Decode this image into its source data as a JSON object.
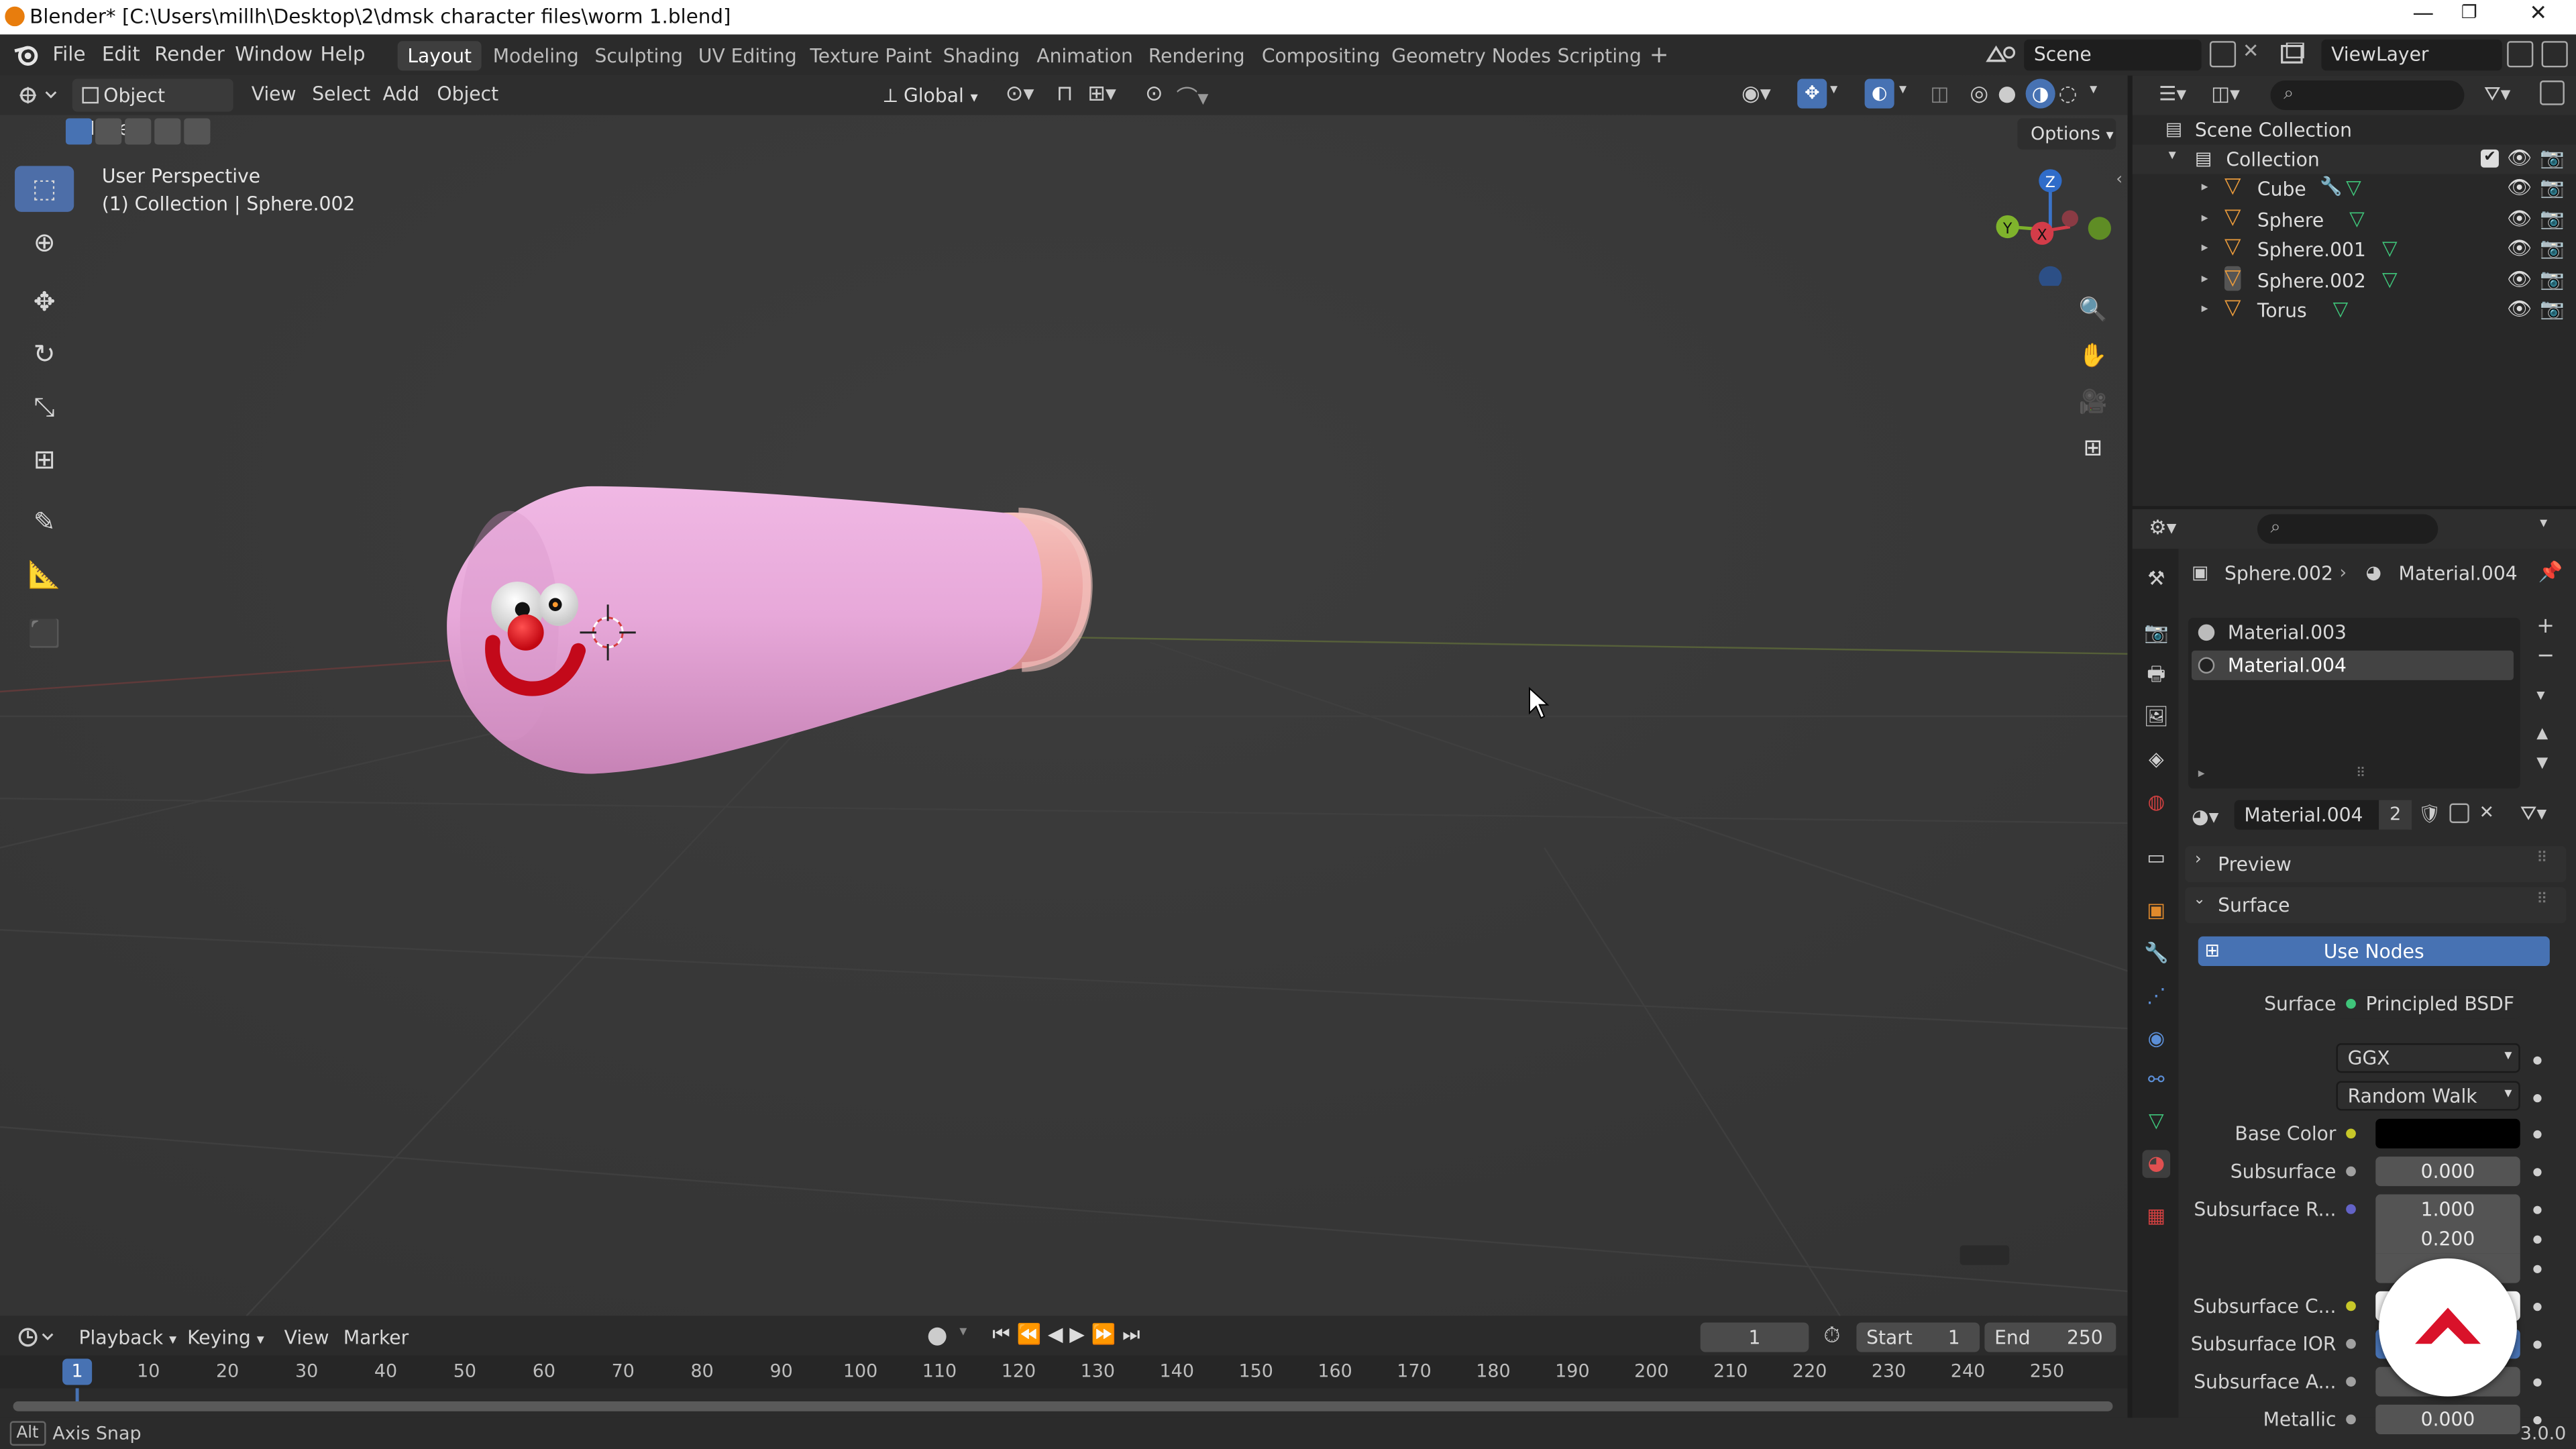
{
  "window": {
    "title": "Blender* [C:\\Users\\millh\\Desktop\\2\\dmsk character files\\worm 1.blend]",
    "controls": [
      "—",
      "❐",
      "✕"
    ]
  },
  "menu": {
    "items": [
      "File",
      "Edit",
      "Render",
      "Window",
      "Help"
    ],
    "workspaces": [
      "Layout",
      "Modeling",
      "Sculpting",
      "UV Editing",
      "Texture Paint",
      "Shading",
      "Animation",
      "Rendering",
      "Compositing",
      "Geometry Nodes",
      "Scripting"
    ],
    "active_workspace": "Layout",
    "add_tab": "+",
    "scene": "Scene",
    "view_layer": "ViewLayer"
  },
  "viewport": {
    "mode": "Object Mode",
    "menus": [
      "View",
      "Select",
      "Add",
      "Object"
    ],
    "orientation": "Global",
    "options_label": "Options",
    "perspective": "User Perspective",
    "collection_info": "(1) Collection | Sphere.002",
    "gizmo": {
      "x": "X",
      "y": "Y",
      "z": "Z"
    },
    "tools": [
      "select-box",
      "cursor",
      "move",
      "rotate",
      "scale",
      "transform",
      "annotate",
      "measure",
      "add-cube"
    ],
    "active_tool": "select-box"
  },
  "timeline": {
    "menus": [
      "Playback",
      "Keying",
      "View",
      "Marker"
    ],
    "current_frame": "1",
    "start_label": "Start",
    "start": "1",
    "end_label": "End",
    "end": "250",
    "ticks": [
      "1",
      "10",
      "20",
      "30",
      "40",
      "50",
      "60",
      "70",
      "80",
      "90",
      "100",
      "110",
      "120",
      "130",
      "140",
      "150",
      "160",
      "170",
      "180",
      "190",
      "200",
      "210",
      "220",
      "230",
      "240",
      "250"
    ],
    "tick_frames": [
      1,
      10,
      20,
      30,
      40,
      50,
      60,
      70,
      80,
      90,
      100,
      110,
      120,
      130,
      140,
      150,
      160,
      170,
      180,
      190,
      200,
      210,
      220,
      230,
      240,
      250
    ]
  },
  "status": {
    "key": "Alt",
    "hint": "Axis Snap",
    "version": "3.0.0"
  },
  "outliner": {
    "scene_collection": "Scene Collection",
    "collection": "Collection",
    "objects": [
      {
        "name": "Cube",
        "selected": false
      },
      {
        "name": "Sphere",
        "selected": false
      },
      {
        "name": "Sphere.001",
        "selected": false
      },
      {
        "name": "Sphere.002",
        "selected": true
      },
      {
        "name": "Torus",
        "selected": false
      }
    ]
  },
  "properties": {
    "breadcrumb_object": "Sphere.002",
    "breadcrumb_material": "Material.004",
    "material_slots": [
      {
        "name": "Material.003",
        "active": false
      },
      {
        "name": "Material.004",
        "active": true
      }
    ],
    "material_name": "Material.004",
    "user_count": "2",
    "preview_label": "Preview",
    "surface_panel": "Surface",
    "use_nodes": "Use Nodes",
    "surface_label": "Surface",
    "surface_shader": "Principled BSDF",
    "distribution": "GGX",
    "subsurface_method": "Random Walk",
    "fields": [
      {
        "label": "Base Color",
        "value": "",
        "socket": "#c7c729"
      },
      {
        "label": "Subsurface",
        "value": "0.000",
        "socket": "#a1a1a1"
      },
      {
        "label": "Subsurface R...",
        "value": "1.000",
        "socket": "#6363c7"
      },
      {
        "label": "",
        "value": "0.200",
        "socket": ""
      },
      {
        "label": "",
        "value": "",
        "socket": ""
      },
      {
        "label": "Subsurface C...",
        "value": "",
        "socket": "#c7c729"
      },
      {
        "label": "Subsurface IOR",
        "value": "",
        "socket": "#a1a1a1"
      },
      {
        "label": "Subsurface A...",
        "value": "",
        "socket": "#a1a1a1"
      },
      {
        "label": "Metallic",
        "value": "0.000",
        "socket": "#a1a1a1"
      }
    ]
  },
  "colors": {
    "accent": "#4772b3",
    "active_tool": "#4d6ea8",
    "worm_body": "#e5a8d8",
    "worm_tail": "#f0b5b0",
    "nose": "#e8101a",
    "overlay_logo": "#d9122a"
  }
}
